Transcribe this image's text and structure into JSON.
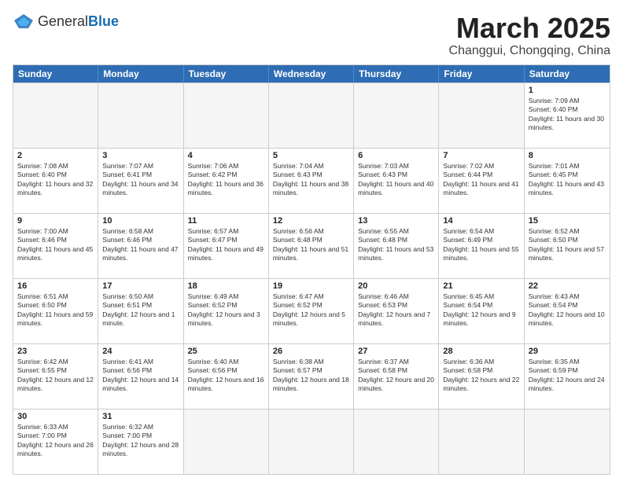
{
  "header": {
    "logo_general": "General",
    "logo_blue": "Blue",
    "month_title": "March 2025",
    "location": "Changgui, Chongqing, China"
  },
  "days_of_week": [
    "Sunday",
    "Monday",
    "Tuesday",
    "Wednesday",
    "Thursday",
    "Friday",
    "Saturday"
  ],
  "rows": [
    [
      {
        "day": "",
        "info": ""
      },
      {
        "day": "",
        "info": ""
      },
      {
        "day": "",
        "info": ""
      },
      {
        "day": "",
        "info": ""
      },
      {
        "day": "",
        "info": ""
      },
      {
        "day": "",
        "info": ""
      },
      {
        "day": "1",
        "info": "Sunrise: 7:09 AM\nSunset: 6:40 PM\nDaylight: 11 hours and 30 minutes."
      }
    ],
    [
      {
        "day": "2",
        "info": "Sunrise: 7:08 AM\nSunset: 6:40 PM\nDaylight: 11 hours and 32 minutes."
      },
      {
        "day": "3",
        "info": "Sunrise: 7:07 AM\nSunset: 6:41 PM\nDaylight: 11 hours and 34 minutes."
      },
      {
        "day": "4",
        "info": "Sunrise: 7:06 AM\nSunset: 6:42 PM\nDaylight: 11 hours and 36 minutes."
      },
      {
        "day": "5",
        "info": "Sunrise: 7:04 AM\nSunset: 6:43 PM\nDaylight: 11 hours and 38 minutes."
      },
      {
        "day": "6",
        "info": "Sunrise: 7:03 AM\nSunset: 6:43 PM\nDaylight: 11 hours and 40 minutes."
      },
      {
        "day": "7",
        "info": "Sunrise: 7:02 AM\nSunset: 6:44 PM\nDaylight: 11 hours and 41 minutes."
      },
      {
        "day": "8",
        "info": "Sunrise: 7:01 AM\nSunset: 6:45 PM\nDaylight: 11 hours and 43 minutes."
      }
    ],
    [
      {
        "day": "9",
        "info": "Sunrise: 7:00 AM\nSunset: 6:46 PM\nDaylight: 11 hours and 45 minutes."
      },
      {
        "day": "10",
        "info": "Sunrise: 6:58 AM\nSunset: 6:46 PM\nDaylight: 11 hours and 47 minutes."
      },
      {
        "day": "11",
        "info": "Sunrise: 6:57 AM\nSunset: 6:47 PM\nDaylight: 11 hours and 49 minutes."
      },
      {
        "day": "12",
        "info": "Sunrise: 6:56 AM\nSunset: 6:48 PM\nDaylight: 11 hours and 51 minutes."
      },
      {
        "day": "13",
        "info": "Sunrise: 6:55 AM\nSunset: 6:48 PM\nDaylight: 11 hours and 53 minutes."
      },
      {
        "day": "14",
        "info": "Sunrise: 6:54 AM\nSunset: 6:49 PM\nDaylight: 11 hours and 55 minutes."
      },
      {
        "day": "15",
        "info": "Sunrise: 6:52 AM\nSunset: 6:50 PM\nDaylight: 11 hours and 57 minutes."
      }
    ],
    [
      {
        "day": "16",
        "info": "Sunrise: 6:51 AM\nSunset: 6:50 PM\nDaylight: 11 hours and 59 minutes."
      },
      {
        "day": "17",
        "info": "Sunrise: 6:50 AM\nSunset: 6:51 PM\nDaylight: 12 hours and 1 minute."
      },
      {
        "day": "18",
        "info": "Sunrise: 6:49 AM\nSunset: 6:52 PM\nDaylight: 12 hours and 3 minutes."
      },
      {
        "day": "19",
        "info": "Sunrise: 6:47 AM\nSunset: 6:52 PM\nDaylight: 12 hours and 5 minutes."
      },
      {
        "day": "20",
        "info": "Sunrise: 6:46 AM\nSunset: 6:53 PM\nDaylight: 12 hours and 7 minutes."
      },
      {
        "day": "21",
        "info": "Sunrise: 6:45 AM\nSunset: 6:54 PM\nDaylight: 12 hours and 9 minutes."
      },
      {
        "day": "22",
        "info": "Sunrise: 6:43 AM\nSunset: 6:54 PM\nDaylight: 12 hours and 10 minutes."
      }
    ],
    [
      {
        "day": "23",
        "info": "Sunrise: 6:42 AM\nSunset: 6:55 PM\nDaylight: 12 hours and 12 minutes."
      },
      {
        "day": "24",
        "info": "Sunrise: 6:41 AM\nSunset: 6:56 PM\nDaylight: 12 hours and 14 minutes."
      },
      {
        "day": "25",
        "info": "Sunrise: 6:40 AM\nSunset: 6:56 PM\nDaylight: 12 hours and 16 minutes."
      },
      {
        "day": "26",
        "info": "Sunrise: 6:38 AM\nSunset: 6:57 PM\nDaylight: 12 hours and 18 minutes."
      },
      {
        "day": "27",
        "info": "Sunrise: 6:37 AM\nSunset: 6:58 PM\nDaylight: 12 hours and 20 minutes."
      },
      {
        "day": "28",
        "info": "Sunrise: 6:36 AM\nSunset: 6:58 PM\nDaylight: 12 hours and 22 minutes."
      },
      {
        "day": "29",
        "info": "Sunrise: 6:35 AM\nSunset: 6:59 PM\nDaylight: 12 hours and 24 minutes."
      }
    ],
    [
      {
        "day": "30",
        "info": "Sunrise: 6:33 AM\nSunset: 7:00 PM\nDaylight: 12 hours and 26 minutes."
      },
      {
        "day": "31",
        "info": "Sunrise: 6:32 AM\nSunset: 7:00 PM\nDaylight: 12 hours and 28 minutes."
      },
      {
        "day": "",
        "info": ""
      },
      {
        "day": "",
        "info": ""
      },
      {
        "day": "",
        "info": ""
      },
      {
        "day": "",
        "info": ""
      },
      {
        "day": "",
        "info": ""
      }
    ]
  ]
}
